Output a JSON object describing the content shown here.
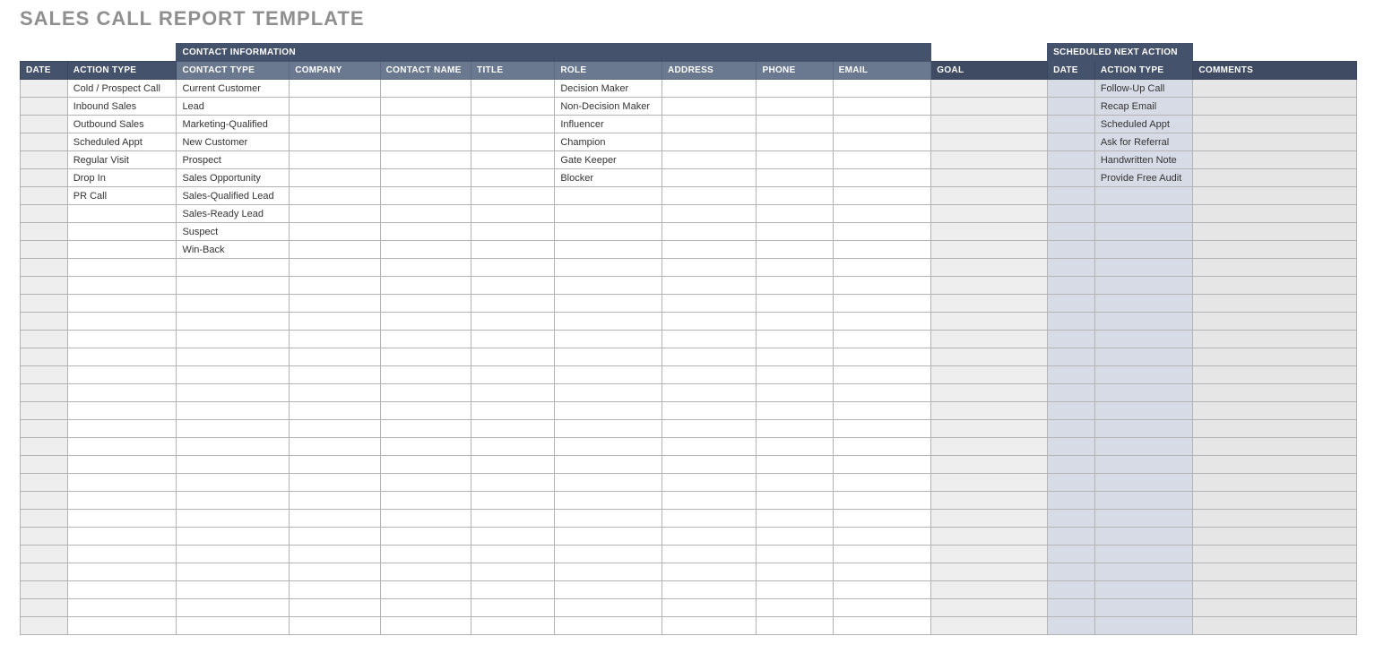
{
  "title": "SALES CALL REPORT TEMPLATE",
  "group_headers": {
    "contact_info": "CONTACT INFORMATION",
    "scheduled_next": "SCHEDULED NEXT ACTION"
  },
  "columns": {
    "date": "DATE",
    "action_type": "ACTION TYPE",
    "contact_type": "CONTACT TYPE",
    "company": "COMPANY",
    "contact_name": "CONTACT NAME",
    "title": "TITLE",
    "role": "ROLE",
    "address": "ADDRESS",
    "phone": "PHONE",
    "email": "EMAIL",
    "goal": "GOAL",
    "next_date": "DATE",
    "next_action_type": "ACTION TYPE",
    "comments": "COMMENTS"
  },
  "rows": [
    {
      "action_type": "Cold / Prospect Call",
      "contact_type": "Current Customer",
      "role": "Decision Maker",
      "next_action_type": "Follow-Up Call"
    },
    {
      "action_type": "Inbound Sales",
      "contact_type": "Lead",
      "role": "Non-Decision Maker",
      "next_action_type": "Recap Email"
    },
    {
      "action_type": "Outbound Sales",
      "contact_type": "Marketing-Qualified",
      "role": "Influencer",
      "next_action_type": "Scheduled Appt"
    },
    {
      "action_type": "Scheduled Appt",
      "contact_type": "New Customer",
      "role": "Champion",
      "next_action_type": "Ask for Referral"
    },
    {
      "action_type": "Regular Visit",
      "contact_type": "Prospect",
      "role": "Gate Keeper",
      "next_action_type": "Handwritten Note"
    },
    {
      "action_type": "Drop In",
      "contact_type": "Sales Opportunity",
      "role": "Blocker",
      "next_action_type": "Provide Free Audit"
    },
    {
      "action_type": "PR Call",
      "contact_type": "Sales-Qualified Lead"
    },
    {
      "contact_type": "Sales-Ready Lead"
    },
    {
      "contact_type": "Suspect"
    },
    {
      "contact_type": "Win-Back"
    },
    {},
    {},
    {},
    {},
    {},
    {},
    {},
    {},
    {},
    {},
    {},
    {},
    {},
    {},
    {},
    {},
    {},
    {},
    {},
    {},
    {}
  ]
}
